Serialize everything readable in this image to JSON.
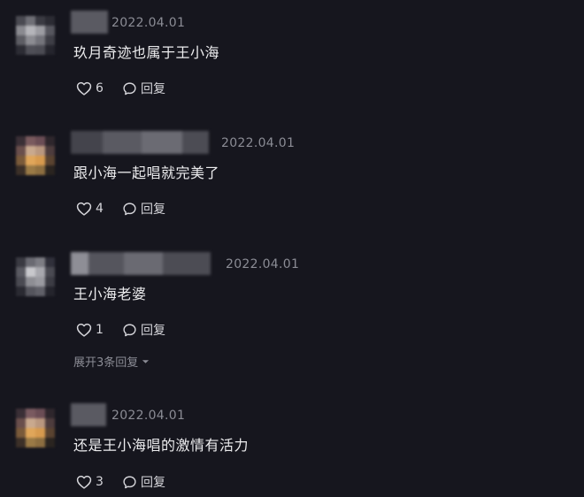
{
  "comments": [
    {
      "date": "2022.04.01",
      "text": "玖月奇迹也属于王小海",
      "likes": "6",
      "reply_label": "回复"
    },
    {
      "date": "2022.04.01",
      "text": "跟小海一起唱就完美了",
      "likes": "4",
      "reply_label": "回复"
    },
    {
      "date": "2022.04.01",
      "text": "王小海老婆",
      "likes": "1",
      "reply_label": "回复",
      "expand_label": "展开3条回复"
    },
    {
      "date": "2022.04.01",
      "text": "还是王小海唱的激情有活力",
      "likes": "3",
      "reply_label": "回复"
    }
  ],
  "icons": {
    "like": "heart-outline-icon",
    "reply": "speech-bubble-icon",
    "expand": "chevron-down-icon"
  },
  "colors": {
    "background": "#16161e",
    "text": "#ececee",
    "muted": "#8b8c95"
  }
}
